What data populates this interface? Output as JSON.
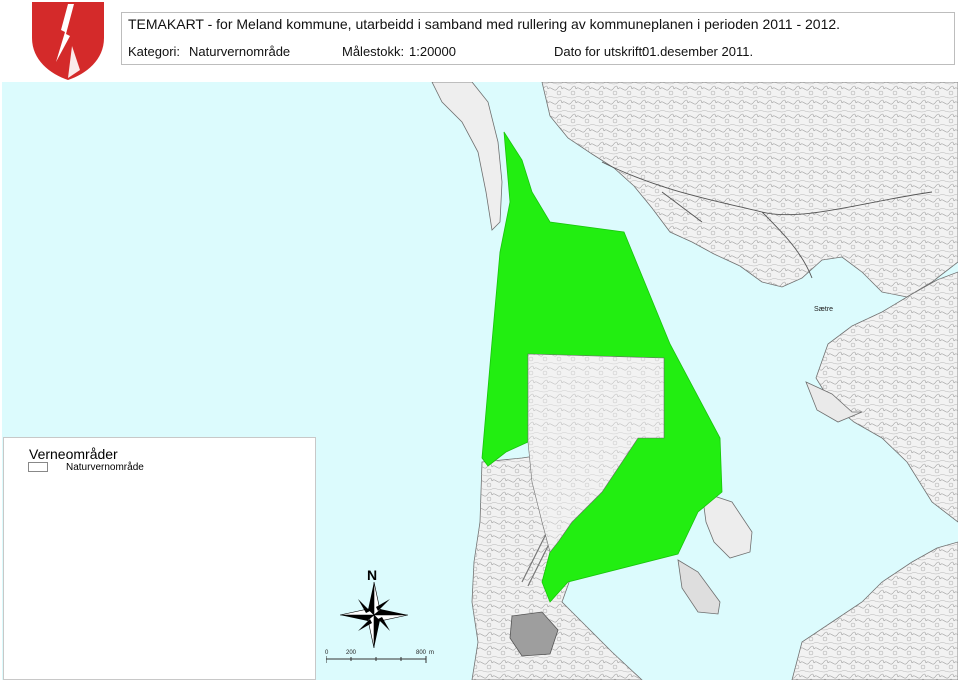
{
  "header": {
    "title": "TEMAKART - for Meland kommune, utarbeidd i samband med rullering av kommuneplanen i perioden 2011 - 2012.",
    "category_label": "Kategori:",
    "category_value": "Naturvernområde",
    "scale_label": "Målestokk:",
    "scale_value": "1:20000",
    "date_label": "Dato for utskrift:",
    "date_value": "01.desember 2011."
  },
  "legend": {
    "title": "Verneområder",
    "items": [
      {
        "label": "Naturvernområde"
      }
    ]
  },
  "map": {
    "place_labels": [
      "Sætre"
    ],
    "north_label": "N",
    "scale_bar_ticks": [
      "0",
      "200",
      "800",
      "m"
    ],
    "colors": {
      "sea": "#dcfbfd",
      "land": "#f4f4f4",
      "protected_area": "#22ee11",
      "crest_red": "#d42a2a"
    }
  }
}
